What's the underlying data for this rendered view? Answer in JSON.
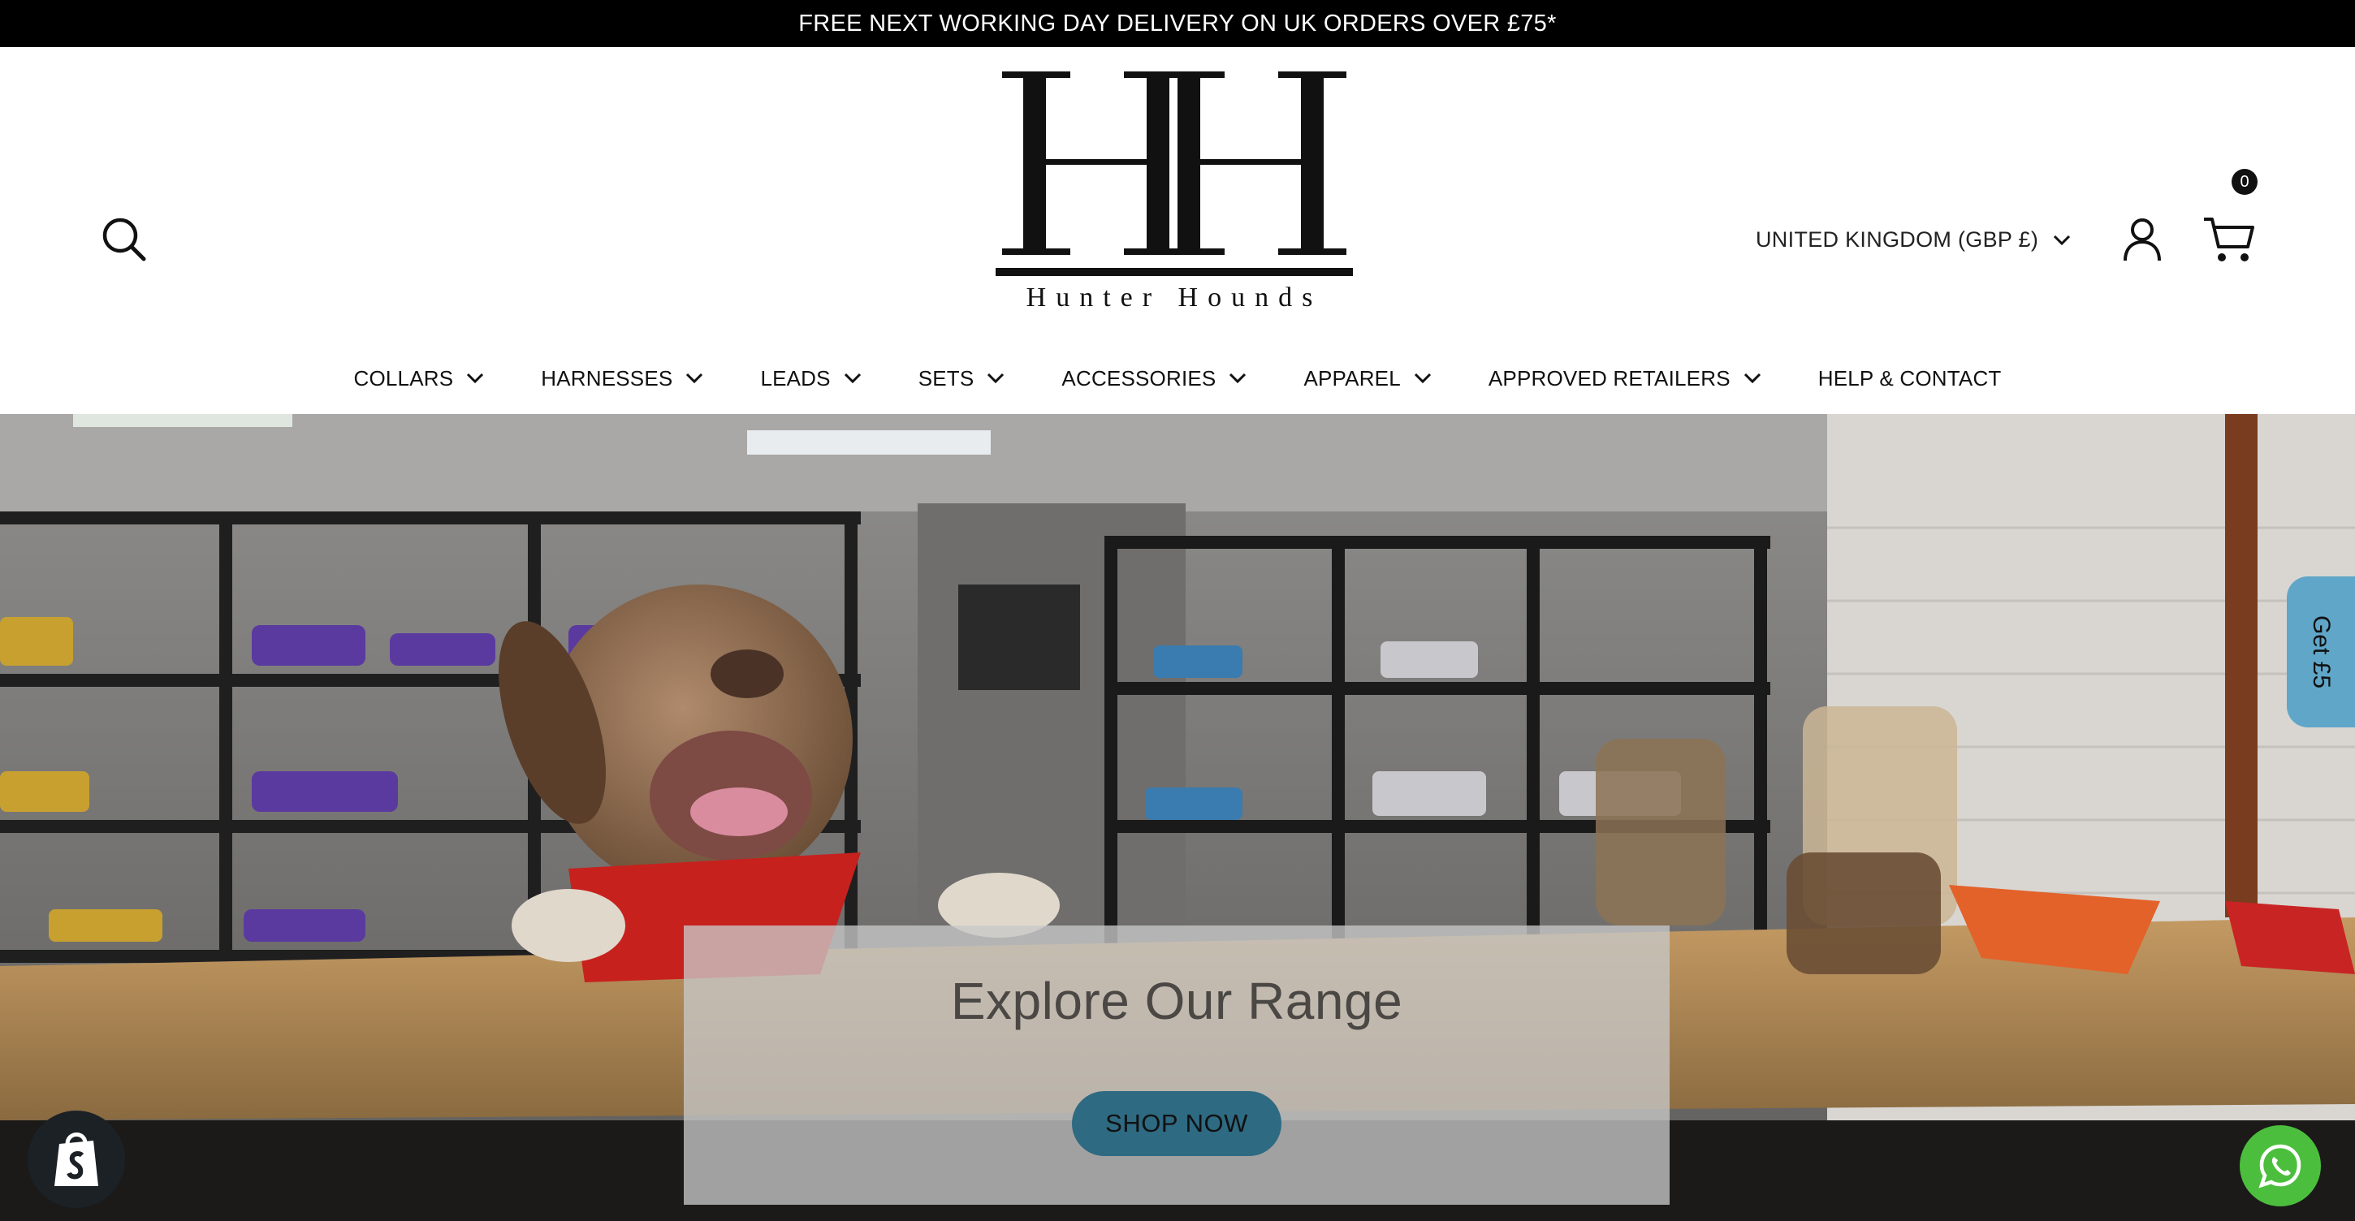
{
  "announcement": {
    "text": "FREE NEXT WORKING DAY DELIVERY ON UK ORDERS OVER £75*"
  },
  "header": {
    "brand_name": "Hunter Hounds",
    "logo_mark": "HH",
    "currency_selector": "UNITED KINGDOM (GBP £)",
    "cart_count": "0",
    "icons": [
      "search-icon",
      "chevron-down-icon",
      "account-icon",
      "cart-icon"
    ]
  },
  "nav": {
    "items": [
      {
        "label": "COLLARS",
        "has_dropdown": true
      },
      {
        "label": "HARNESSES",
        "has_dropdown": true
      },
      {
        "label": "LEADS",
        "has_dropdown": true
      },
      {
        "label": "SETS",
        "has_dropdown": true
      },
      {
        "label": "ACCESSORIES",
        "has_dropdown": true
      },
      {
        "label": "APPAREL",
        "has_dropdown": true
      },
      {
        "label": "APPROVED RETAILERS",
        "has_dropdown": true
      },
      {
        "label": "HELP & CONTACT",
        "has_dropdown": false
      }
    ]
  },
  "hero": {
    "title": "Explore Our Range",
    "cta_label": "SHOP NOW"
  },
  "side_tab": {
    "label": "Get £5"
  },
  "floating": {
    "shopify_icon": "shopify-bag-icon",
    "whatsapp_icon": "whatsapp-icon"
  },
  "colors": {
    "announcement_bg": "#000000",
    "cta_bg": "#2e6a82",
    "side_tab_bg": "#5fa6c8",
    "whatsapp_bg": "#4cbe3d",
    "shopify_bg": "#1c2126"
  }
}
